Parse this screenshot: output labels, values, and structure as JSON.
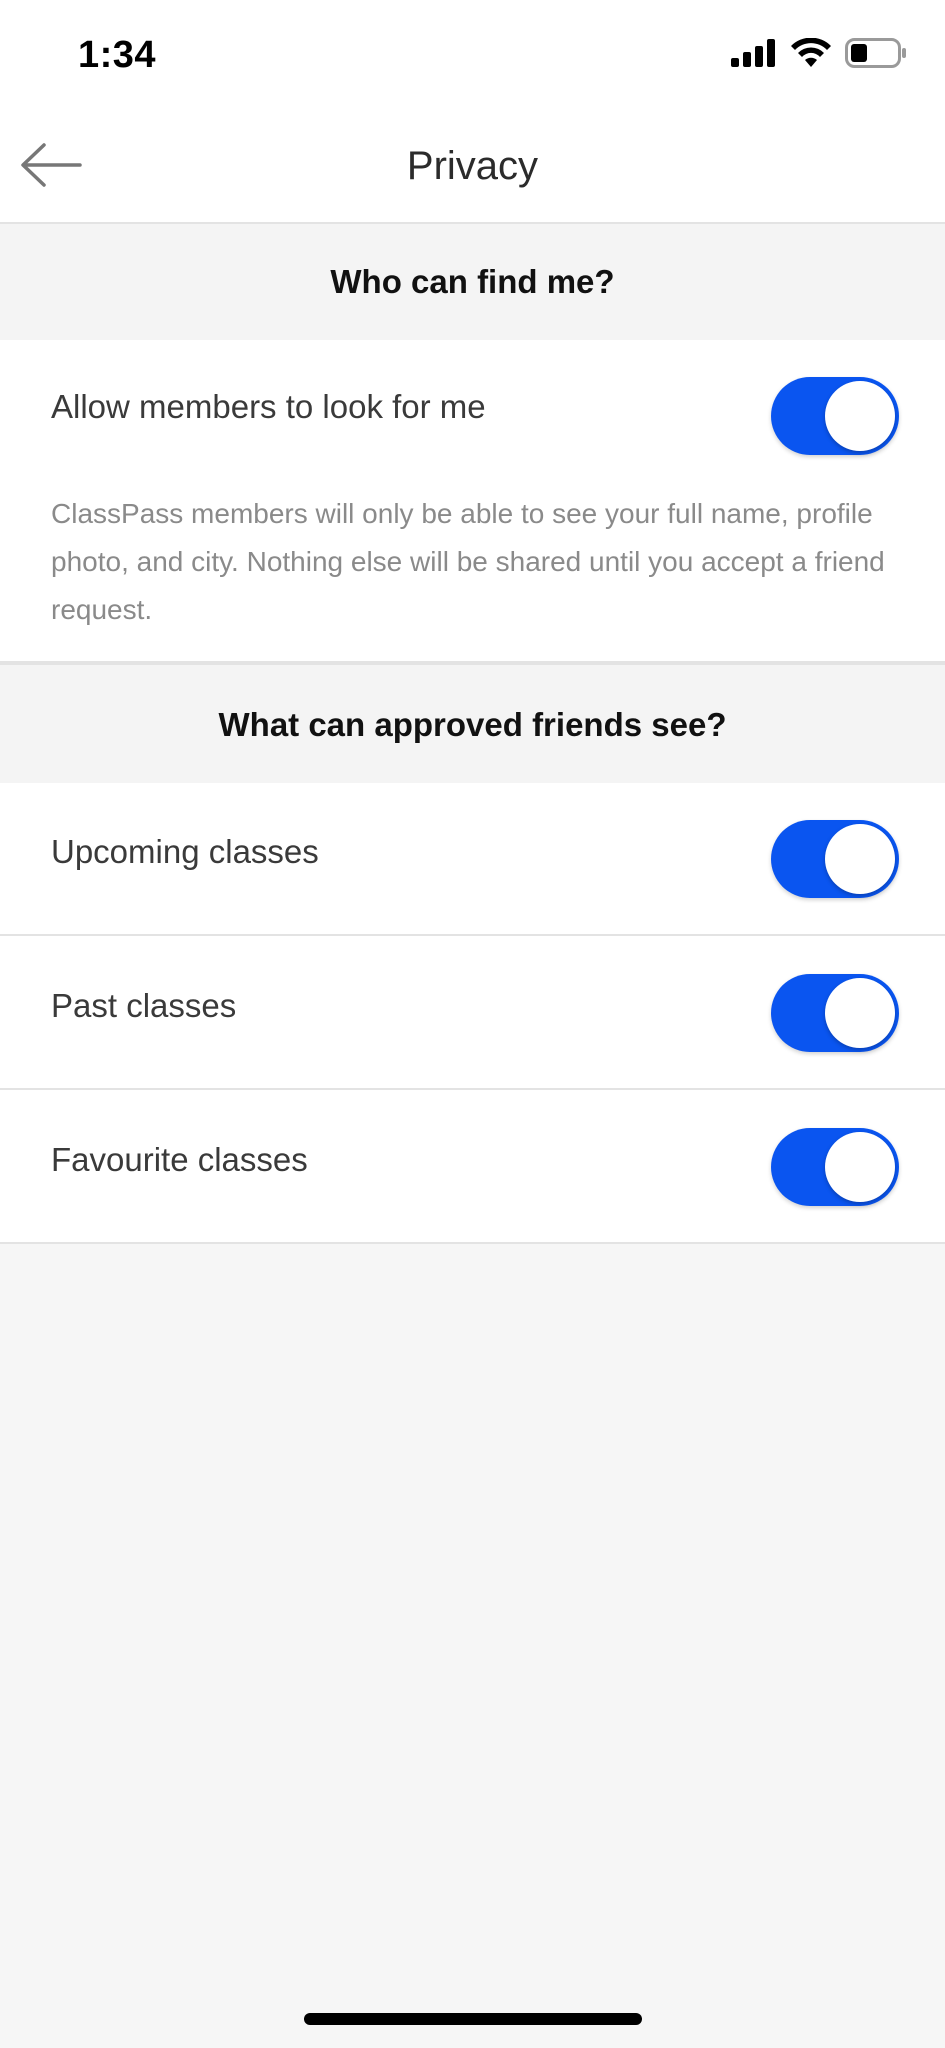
{
  "status_bar": {
    "time": "1:34",
    "icons": [
      "cellular-signal-icon",
      "wifi-icon",
      "battery-icon"
    ]
  },
  "nav": {
    "title": "Privacy",
    "back_icon": "arrow-left-icon"
  },
  "sections": [
    {
      "header": "Who can find me?",
      "rows": [
        {
          "label": "Allow members to look for me",
          "toggle_on": true,
          "description": "ClassPass members will only be able to see your full name, profile photo, and city. Nothing else will be shared until you accept a friend request."
        }
      ]
    },
    {
      "header": "What can approved friends see?",
      "rows": [
        {
          "label": "Upcoming classes",
          "toggle_on": true
        },
        {
          "label": "Past classes",
          "toggle_on": true
        },
        {
          "label": "Favourite classes",
          "toggle_on": true
        }
      ]
    }
  ],
  "colors": {
    "toggle_on": "#0a55f0",
    "background": "#f6f6f6",
    "surface": "#ffffff"
  }
}
